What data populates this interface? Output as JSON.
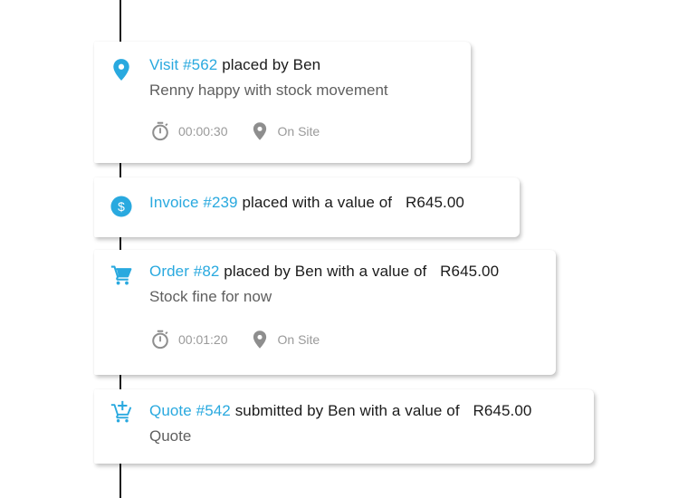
{
  "colors": {
    "accent": "#29a9df",
    "text": "#1b1b1b",
    "muted": "#5f5f5f",
    "meta": "#9a9a9a",
    "line": "#1d1d1d"
  },
  "items": [
    {
      "type": "visit",
      "icon": "map-pin-icon",
      "link": "Visit #562",
      "text": "placed by Ben",
      "amount": "",
      "subtitle": "Renny happy with stock movement",
      "duration": "00:00:30",
      "location": "On Site"
    },
    {
      "type": "invoice",
      "icon": "dollar-circle-icon",
      "link": "Invoice #239",
      "text": "placed with a value of",
      "amount": "R645.00"
    },
    {
      "type": "order",
      "icon": "cart-icon",
      "link": "Order #82",
      "text": "placed by Ben with a value of",
      "amount": "R645.00",
      "subtitle": "Stock fine for now",
      "duration": "00:01:20",
      "location": "On Site"
    },
    {
      "type": "quote",
      "icon": "cart-add-icon",
      "link": "Quote #542",
      "text": "submitted by Ben with a value of",
      "amount": "R645.00",
      "subtitle": "Quote"
    }
  ]
}
